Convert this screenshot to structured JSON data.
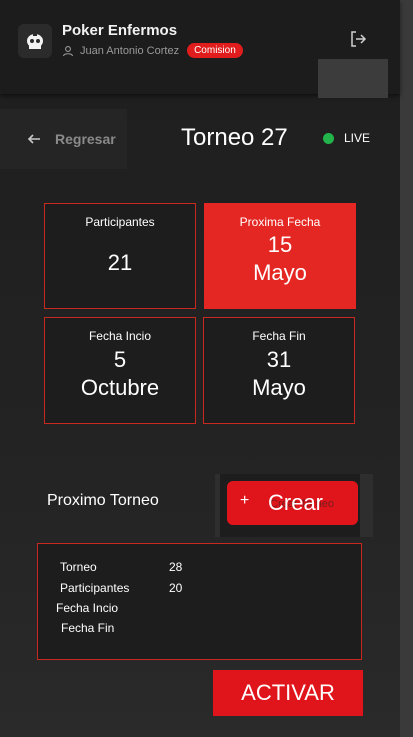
{
  "header": {
    "app_title": "Poker Enfermos",
    "user_name": "Juan Antonio Cortez",
    "role_badge": "Comision",
    "logout_icon": "logout-icon",
    "user_icon": "user-icon"
  },
  "title_row": {
    "back_label": "Regresar",
    "tournament_title": "Torneo 27",
    "live_label": "LIVE",
    "live_color": "#22b34a"
  },
  "stats": {
    "participantes": {
      "label": "Participantes",
      "value": "21"
    },
    "proxima_fecha": {
      "label": "Proxima Fecha",
      "value_line1": "15",
      "value_line2": "Mayo"
    },
    "fecha_inicio": {
      "label": "Fecha Incio",
      "value_line1": "5",
      "value_line2": "Octubre"
    },
    "fecha_fin": {
      "label": "Fecha Fin",
      "value_line1": "31",
      "value_line2": "Mayo"
    }
  },
  "next_tournament": {
    "title": "Proximo Torneo",
    "create_button_label": "Crear",
    "create_button_ghost": "Crear Torneo",
    "rows": [
      {
        "label": "Torneo",
        "value": "28"
      },
      {
        "label": "Participantes",
        "value": "20"
      },
      {
        "label": "Fecha Incio",
        "value": ""
      },
      {
        "label": "Fecha Fin",
        "value": ""
      }
    ]
  },
  "activate_button": "ACTIVAR",
  "colors": {
    "accent": "#e0141b",
    "card_border": "#c8291f",
    "background": "#1f1f1f"
  }
}
